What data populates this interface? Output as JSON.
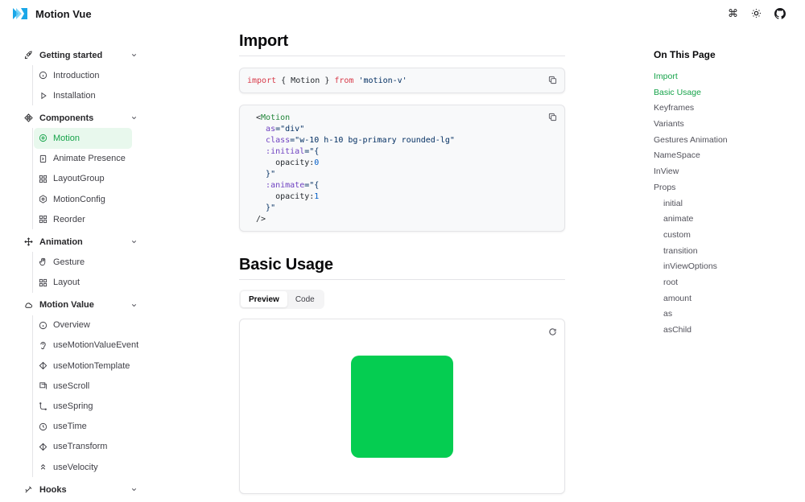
{
  "brand": {
    "name": "Motion Vue",
    "color": "#1aa7e8"
  },
  "header_icons": [
    "command-icon",
    "sun-icon",
    "github-icon"
  ],
  "sidebar": {
    "groups": [
      {
        "label": "Getting started",
        "icon": "rocket-icon",
        "items": [
          {
            "label": "Introduction",
            "icon": "info-circle-icon"
          },
          {
            "label": "Installation",
            "icon": "play-icon"
          }
        ]
      },
      {
        "label": "Components",
        "icon": "component-icon",
        "items": [
          {
            "label": "Motion",
            "icon": "motion-circle-icon",
            "active": true
          },
          {
            "label": "Animate Presence",
            "icon": "file-exit-icon"
          },
          {
            "label": "LayoutGroup",
            "icon": "grid-icon"
          },
          {
            "label": "MotionConfig",
            "icon": "settings-icon"
          },
          {
            "label": "Reorder",
            "icon": "grid-icon"
          }
        ]
      },
      {
        "label": "Animation",
        "icon": "move-icon",
        "items": [
          {
            "label": "Gesture",
            "icon": "hand-icon"
          },
          {
            "label": "Layout",
            "icon": "grid-icon"
          }
        ]
      },
      {
        "label": "Motion Value",
        "icon": "cloud-icon",
        "items": [
          {
            "label": "Overview",
            "icon": "info-circle-icon"
          },
          {
            "label": "useMotionValueEvent",
            "icon": "ear-icon"
          },
          {
            "label": "useMotionTemplate",
            "icon": "shapes-icon"
          },
          {
            "label": "useScroll",
            "icon": "scroll-icon"
          },
          {
            "label": "useSpring",
            "icon": "spring-icon"
          },
          {
            "label": "useTime",
            "icon": "clock-icon"
          },
          {
            "label": "useTransform",
            "icon": "transform-icon"
          },
          {
            "label": "useVelocity",
            "icon": "chevrons-up-icon"
          }
        ]
      },
      {
        "label": "Hooks",
        "icon": "hook-icon",
        "items": []
      }
    ]
  },
  "main": {
    "import_heading": "Import",
    "import_code": {
      "kw1": "import",
      "mid": " { Motion } ",
      "kw2": "from",
      "str": " 'motion-v'"
    },
    "usage_code": {
      "l1_open": "<",
      "l1_tag": "Motion",
      "l2_attr": "as",
      "l2_rest": "=\"div\"",
      "l3_attr": "class",
      "l3_rest": "=\"w-10 h-10 bg-primary rounded-lg\"",
      "l4_attr": ":initial",
      "l4_rest": "=\"{",
      "l5_key": "opacity:",
      "l5_num": "0",
      "l6": "}\"",
      "l7_attr": ":animate",
      "l7_rest": "=\"{",
      "l8_key": "opacity:",
      "l8_num": "1",
      "l9": "}\"",
      "l10": "/>"
    },
    "basic_heading": "Basic Usage",
    "tabs": {
      "preview": "Preview",
      "code": "Code"
    },
    "preview_box_color": "#05cd51"
  },
  "toc": {
    "title": "On This Page",
    "items": [
      {
        "label": "Import",
        "highlight": true
      },
      {
        "label": "Basic Usage",
        "highlight": true
      },
      {
        "label": "Keyframes"
      },
      {
        "label": "Variants"
      },
      {
        "label": "Gestures Animation"
      },
      {
        "label": "NameSpace"
      },
      {
        "label": "InView"
      },
      {
        "label": "Props"
      },
      {
        "label": "initial",
        "sub": true
      },
      {
        "label": "animate",
        "sub": true
      },
      {
        "label": "custom",
        "sub": true
      },
      {
        "label": "transition",
        "sub": true
      },
      {
        "label": "inViewOptions",
        "sub": true
      },
      {
        "label": "root",
        "sub": true
      },
      {
        "label": "amount",
        "sub": true
      },
      {
        "label": "as",
        "sub": true
      },
      {
        "label": "asChild",
        "sub": true
      }
    ]
  },
  "colors": {
    "accent": "#16a34a",
    "active_bg": "#e8f8ed"
  }
}
